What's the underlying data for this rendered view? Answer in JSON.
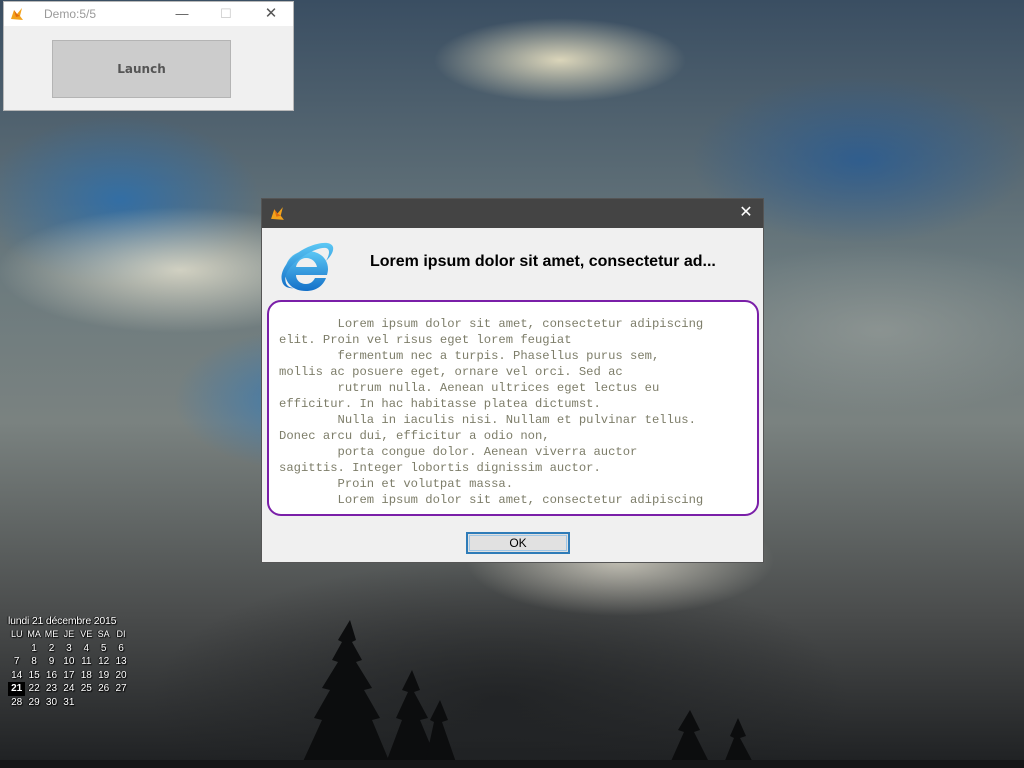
{
  "launcher": {
    "title": "Demo:5/5",
    "minimize_glyph": "—",
    "maximize_glyph": "☐",
    "close_glyph": "✕",
    "launch_label": "Launch"
  },
  "dialog": {
    "close_glyph": "✕",
    "heading": "Lorem ipsum dolor sit amet, consectetur ad...",
    "body_text": "        Lorem ipsum dolor sit amet, consectetur adipiscing\nelit. Proin vel risus eget lorem feugiat\n        fermentum nec a turpis. Phasellus purus sem,\nmollis ac posuere eget, ornare vel orci. Sed ac\n        rutrum nulla. Aenean ultrices eget lectus eu\nefficitur. In hac habitasse platea dictumst.\n        Nulla in iaculis nisi. Nullam et pulvinar tellus.\nDonec arcu dui, efficitur a odio non,\n        porta congue dolor. Aenean viverra auctor\nsagittis. Integer lobortis dignissim auctor.\n        Proin et volutpat massa.\n        Lorem ipsum dolor sit amet, consectetur adipiscing",
    "ok_label": "OK",
    "icon": "internet-explorer-icon"
  },
  "calendar": {
    "title": "lundi 21 décembre 2015",
    "weekdays": [
      "LU",
      "MA",
      "ME",
      "JE",
      "VE",
      "SA",
      "DI"
    ],
    "weeks": [
      [
        "",
        "1",
        "2",
        "3",
        "4",
        "5",
        "6"
      ],
      [
        "7",
        "8",
        "9",
        "10",
        "11",
        "12",
        "13"
      ],
      [
        "14",
        "15",
        "16",
        "17",
        "18",
        "19",
        "20"
      ],
      [
        "21",
        "22",
        "23",
        "24",
        "25",
        "26",
        "27"
      ],
      [
        "28",
        "29",
        "30",
        "31",
        "",
        "",
        ""
      ]
    ],
    "today": "21"
  },
  "colors": {
    "dialog_titlebar": "#444444",
    "textbox_border": "#7a1fa8",
    "ok_focus_border": "#2f7cb8"
  }
}
